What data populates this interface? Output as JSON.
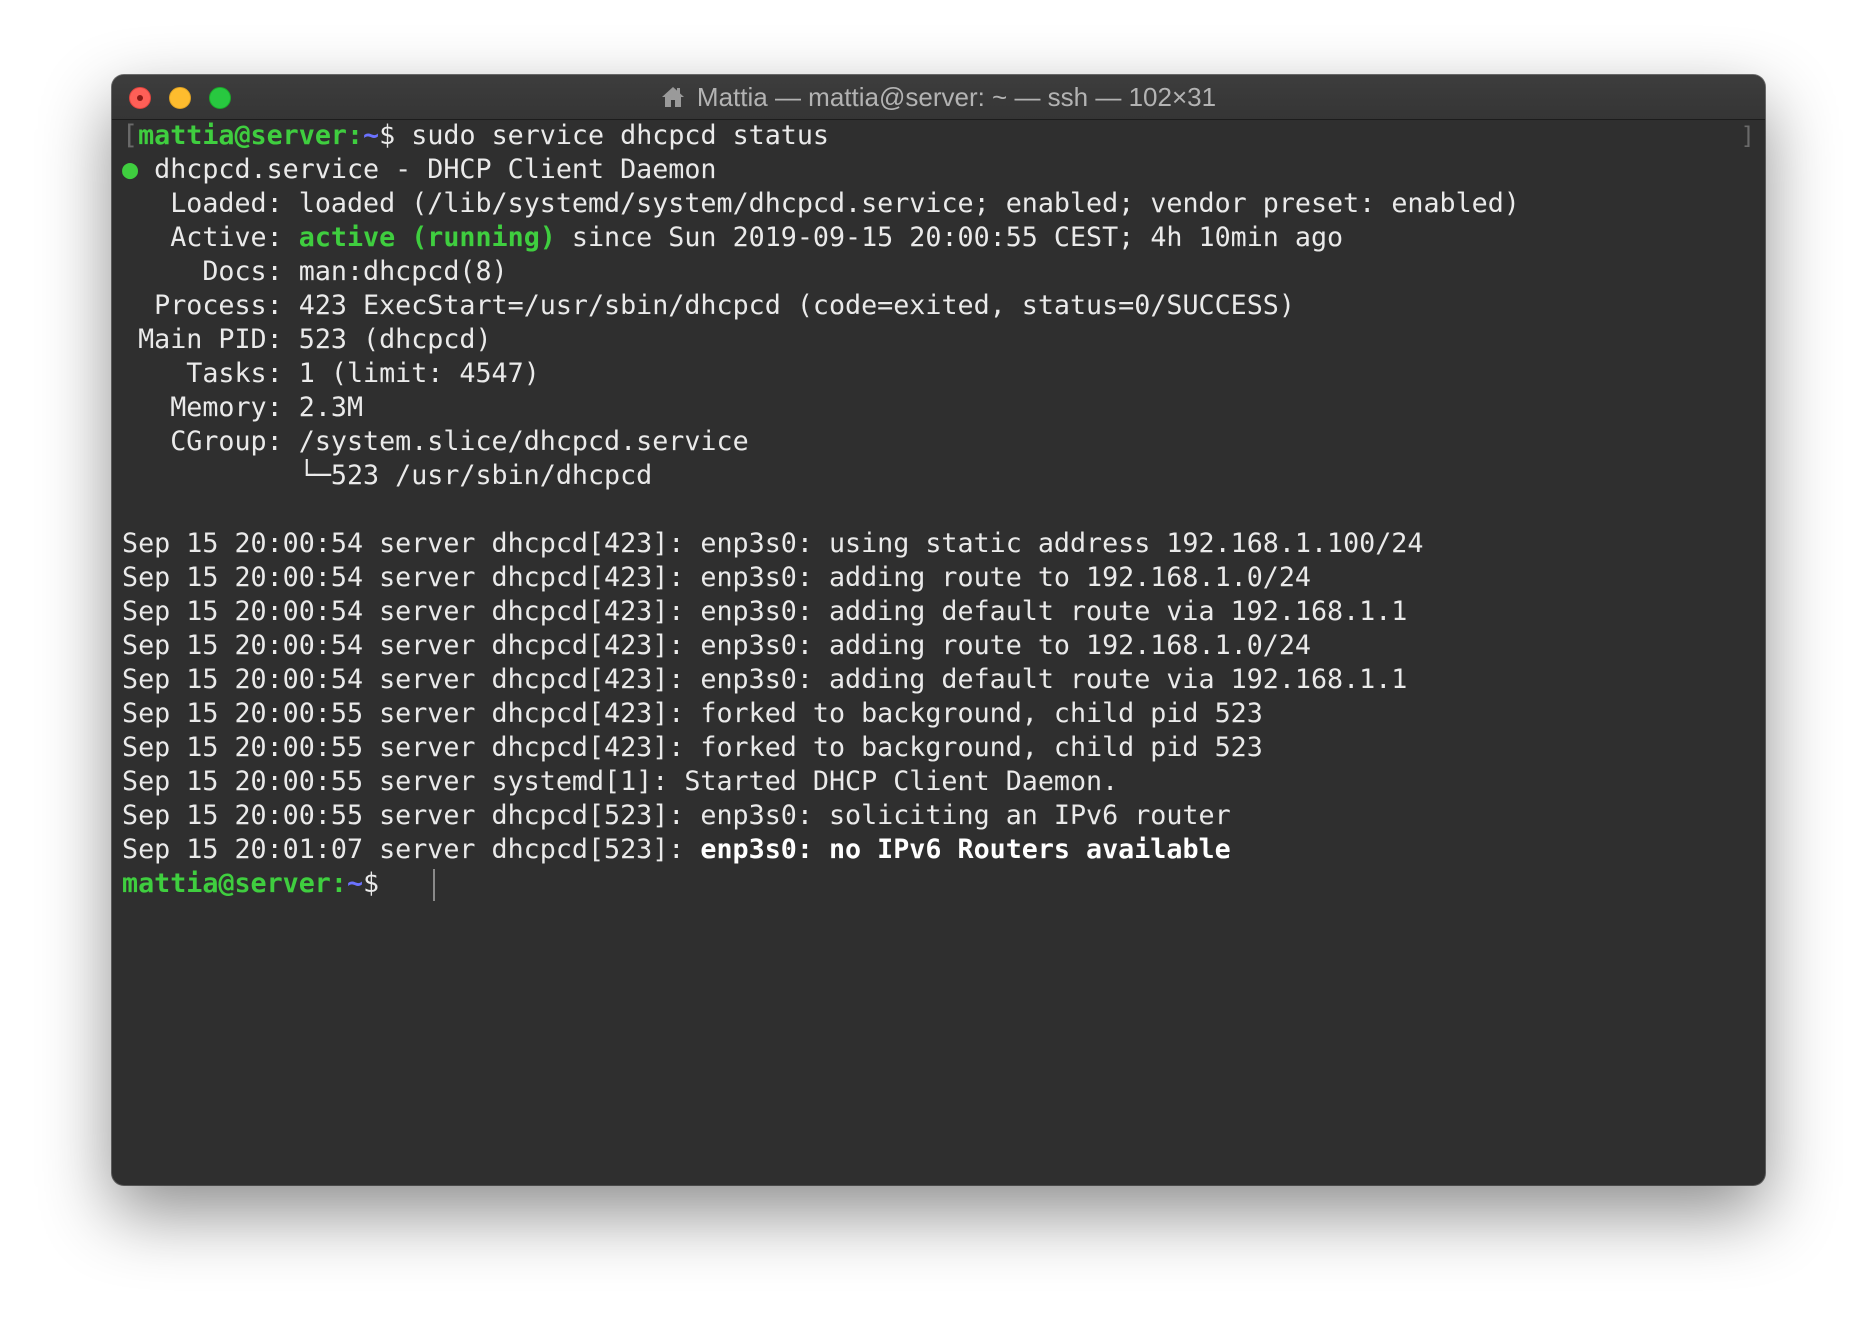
{
  "window": {
    "title": "Mattia — mattia@server: ~ — ssh — 102×31",
    "icon": "home-icon"
  },
  "prompt": {
    "user_host": "mattia@server",
    "sep": ":",
    "path": "~",
    "symbol": "$ "
  },
  "command": "sudo service dhcpcd status",
  "status": {
    "bullet": "●",
    "header": " dhcpcd.service - DHCP Client Daemon",
    "loaded_label": "   Loaded: ",
    "loaded_value": "loaded (/lib/systemd/system/dhcpcd.service; enabled; vendor preset: enabled)",
    "active_label": "   Active: ",
    "active_state": "active (running)",
    "active_since": " since Sun 2019-09-15 20:00:55 CEST; 4h 10min ago",
    "docs_label": "     Docs: ",
    "docs_value": "man:dhcpcd(8)",
    "process_label": "  Process: ",
    "process_value": "423 ExecStart=/usr/sbin/dhcpcd (code=exited, status=0/SUCCESS)",
    "mainpid_label": " Main PID: ",
    "mainpid_value": "523 (dhcpcd)",
    "tasks_label": "    Tasks: ",
    "tasks_value": "1 (limit: 4547)",
    "memory_label": "   Memory: ",
    "memory_value": "2.3M",
    "cgroup_label": "   CGroup: ",
    "cgroup_value": "/system.slice/dhcpcd.service",
    "cgroup_child": "           └─523 /usr/sbin/dhcpcd"
  },
  "logs": [
    "Sep 15 20:00:54 server dhcpcd[423]: enp3s0: using static address 192.168.1.100/24",
    "Sep 15 20:00:54 server dhcpcd[423]: enp3s0: adding route to 192.168.1.0/24",
    "Sep 15 20:00:54 server dhcpcd[423]: enp3s0: adding default route via 192.168.1.1",
    "Sep 15 20:00:54 server dhcpcd[423]: enp3s0: adding route to 192.168.1.0/24",
    "Sep 15 20:00:54 server dhcpcd[423]: enp3s0: adding default route via 192.168.1.1",
    "Sep 15 20:00:55 server dhcpcd[423]: forked to background, child pid 523",
    "Sep 15 20:00:55 server dhcpcd[423]: forked to background, child pid 523",
    "Sep 15 20:00:55 server systemd[1]: Started DHCP Client Daemon.",
    "Sep 15 20:00:55 server dhcpcd[523]: enp3s0: soliciting an IPv6 router"
  ],
  "last_log": {
    "prefix": "Sep 15 20:01:07 server dhcpcd[523]: ",
    "message": "enp3s0: no IPv6 Routers available"
  }
}
